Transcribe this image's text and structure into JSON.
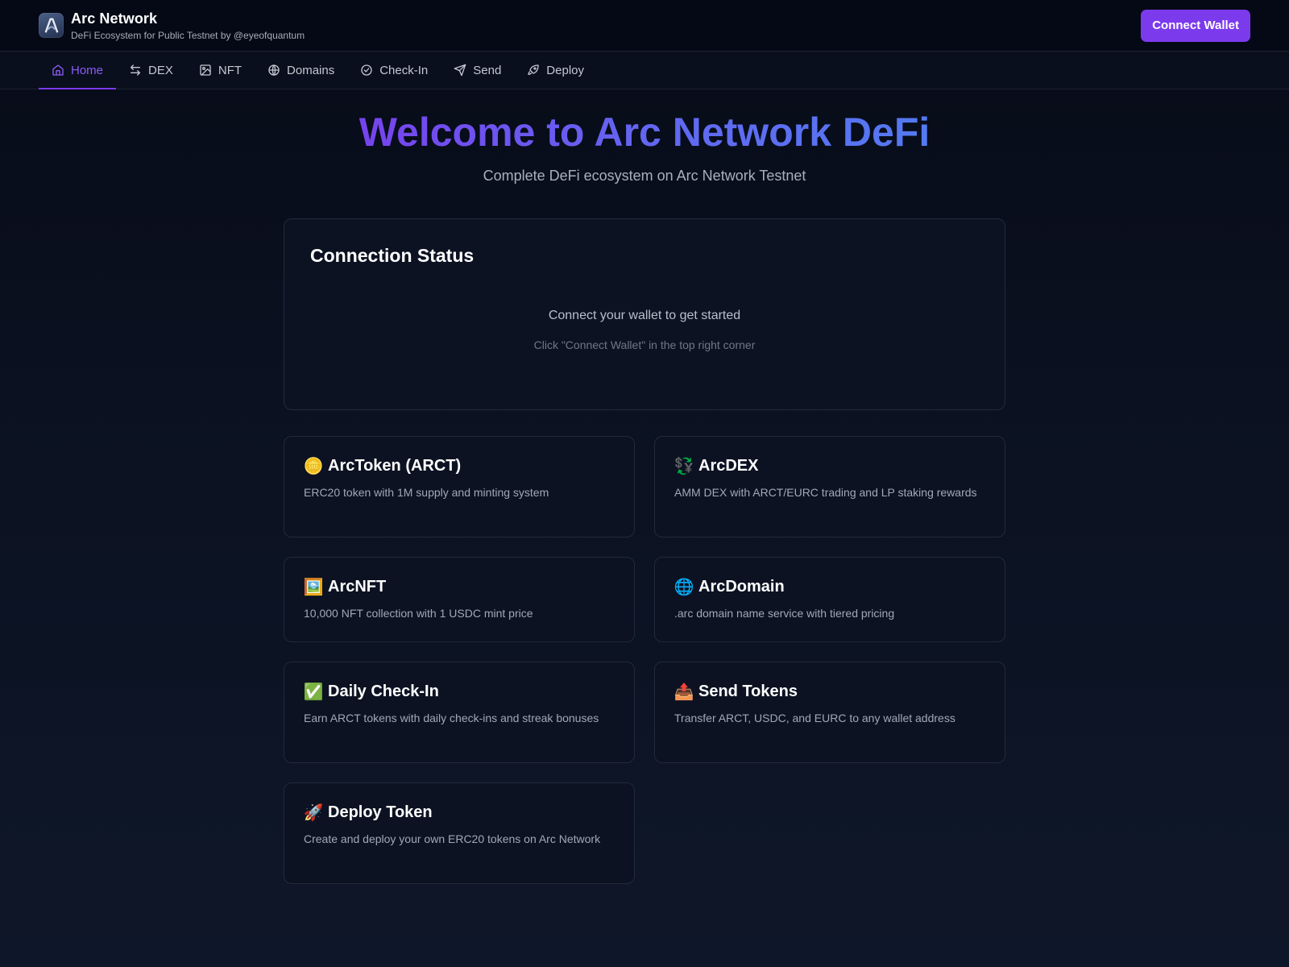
{
  "header": {
    "title": "Arc Network",
    "subtitle": "DeFi Ecosystem for Public Testnet by @eyeofquantum",
    "connect_label": "Connect Wallet"
  },
  "nav": {
    "items": [
      {
        "label": "Home",
        "icon": "home-icon",
        "active": true
      },
      {
        "label": "DEX",
        "icon": "swap-arrows-icon"
      },
      {
        "label": "NFT",
        "icon": "image-icon"
      },
      {
        "label": "Domains",
        "icon": "globe-icon"
      },
      {
        "label": "Check-In",
        "icon": "check-circle-icon"
      },
      {
        "label": "Send",
        "icon": "send-icon"
      },
      {
        "label": "Deploy",
        "icon": "rocket-icon"
      }
    ]
  },
  "hero": {
    "title": "Welcome to Arc Network DeFi",
    "subtitle": "Complete DeFi ecosystem on Arc Network Testnet"
  },
  "status": {
    "title": "Connection Status",
    "message": "Connect your wallet to get started",
    "hint": "Click \"Connect Wallet\" in the top right corner"
  },
  "features": [
    {
      "emoji": "🪙",
      "title": "ArcToken (ARCT)",
      "desc": "ERC20 token with 1M supply and minting system"
    },
    {
      "emoji": "💱",
      "title": "ArcDEX",
      "desc": "AMM DEX with ARCT/EURC trading and LP staking rewards"
    },
    {
      "emoji": "🖼️",
      "title": "ArcNFT",
      "desc": "10,000 NFT collection with 1 USDC mint price"
    },
    {
      "emoji": "🌐",
      "title": "ArcDomain",
      "desc": ".arc domain name service with tiered pricing"
    },
    {
      "emoji": "✅",
      "title": "Daily Check-In",
      "desc": "Earn ARCT tokens with daily check-ins and streak bonuses"
    },
    {
      "emoji": "📤",
      "title": "Send Tokens",
      "desc": "Transfer ARCT, USDC, and EURC to any wallet address"
    },
    {
      "emoji": "🚀",
      "title": "Deploy Token",
      "desc": "Create and deploy your own ERC20 tokens on Arc Network"
    }
  ],
  "colors": {
    "accent": "#7c3aed",
    "background": "#0b1120",
    "card": "#0c1222"
  }
}
